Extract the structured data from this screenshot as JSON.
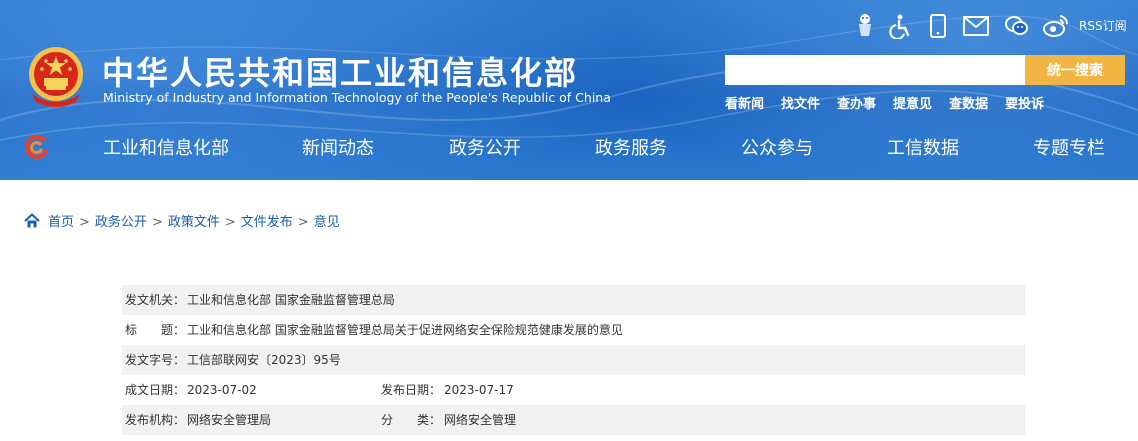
{
  "header": {
    "title_cn": "中华人民共和国工业和信息化部",
    "title_en": "Ministry of Industry and Information Technology of the People's Republic of China",
    "icons": [
      "mascot-icon",
      "accessibility-icon",
      "mobile-icon",
      "mail-icon",
      "wechat-icon",
      "weibo-icon"
    ],
    "rss_label": "RSS订阅",
    "search": {
      "placeholder": "",
      "button": "统一搜索"
    },
    "quick_links": [
      "看新闻",
      "找文件",
      "查办事",
      "提意见",
      "查数据",
      "要投诉"
    ]
  },
  "nav": {
    "items": [
      "工业和信息化部",
      "新闻动态",
      "政务公开",
      "政务服务",
      "公众参与",
      "工信数据",
      "专题专栏"
    ]
  },
  "breadcrumb": {
    "items": [
      "首页",
      "政务公开",
      "政策文件",
      "文件发布",
      "意见"
    ],
    "separator": ">"
  },
  "document_meta": {
    "issuer_label": "发文机关：",
    "issuer": "工业和信息化部 国家金融监督管理总局",
    "title_label": "标　　题：",
    "title": "工业和信息化部 国家金融监督管理总局关于促进网络安全保险规范健康发展的意见",
    "doc_no_label": "发文字号：",
    "doc_no": "工信部联网安〔2023〕95号",
    "written_date_label": "成文日期：",
    "written_date": "2023-07-02",
    "publish_date_label": "发布日期：",
    "publish_date": "2023-07-17",
    "org_label": "发布机构：",
    "org": "网络安全管理局",
    "category_label": "分　　类：",
    "category": "网络安全管理"
  },
  "colors": {
    "header_blue": "#1c64c0",
    "search_button": "#f2b544",
    "link_blue": "#1a5cb4",
    "row_shade": "#f1f1f1"
  }
}
